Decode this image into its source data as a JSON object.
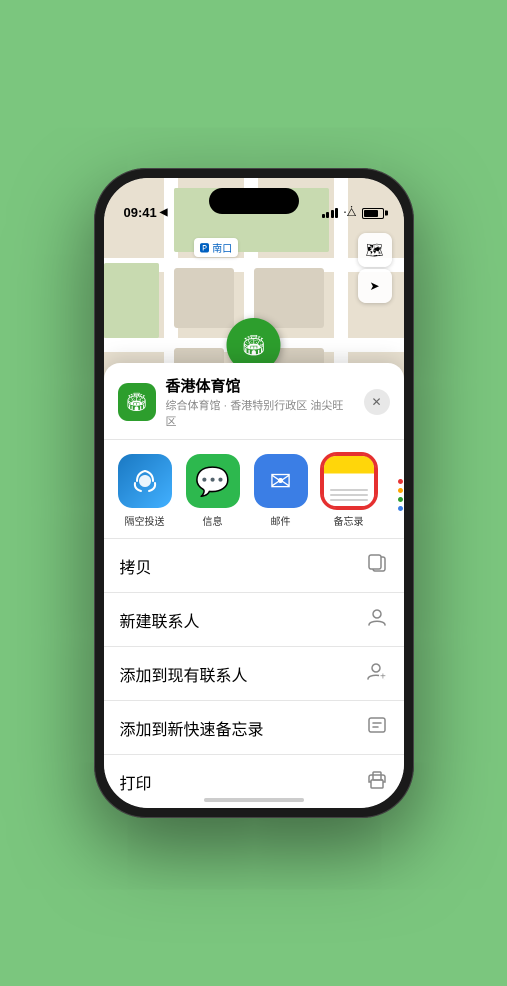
{
  "statusBar": {
    "time": "09:41",
    "locationIcon": "▶"
  },
  "mapLabel": {
    "text": "🅿 南口"
  },
  "pin": {
    "label": "香港体育馆"
  },
  "controls": {
    "mapIcon": "🗺",
    "locationIcon": "⬆"
  },
  "sheet": {
    "closeBtn": "✕",
    "locationName": "香港体育馆",
    "locationSub": "综合体育馆 · 香港特别行政区 油尖旺区",
    "shareItems": [
      {
        "id": "airdrop",
        "label": "隔空投送"
      },
      {
        "id": "messages",
        "label": "信息"
      },
      {
        "id": "mail",
        "label": "邮件"
      },
      {
        "id": "notes",
        "label": "备忘录"
      }
    ],
    "actionItems": [
      {
        "label": "拷贝",
        "icon": "⿻"
      },
      {
        "label": "新建联系人",
        "icon": "👤"
      },
      {
        "label": "添加到现有联系人",
        "icon": "👤"
      },
      {
        "label": "添加到新快速备忘录",
        "icon": "📝"
      },
      {
        "label": "打印",
        "icon": "🖨"
      }
    ]
  }
}
